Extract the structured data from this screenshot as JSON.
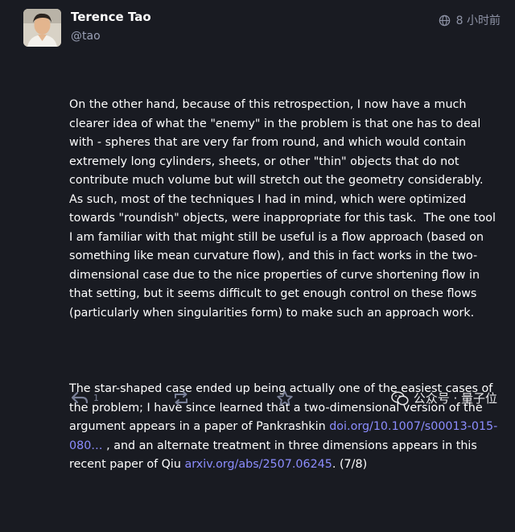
{
  "author": {
    "name": "Terence Tao",
    "handle": "@tao"
  },
  "meta": {
    "time_ago": "8 小时前",
    "globe_icon": "globe-icon"
  },
  "post": {
    "paragraph1": "On the other hand, because of this retrospection, I now have a much clearer idea of what the \"enemy\" in the problem is that one has to deal with - spheres that are very far from round, and which would contain extremely long cylinders, sheets, or other \"thin\" objects that do not contribute much volume but will stretch out the geometry considerably.  As such, most of the techniques I had in mind, which were optimized towards \"roundish\" objects, were inappropriate for this task.  The one tool I am familiar with that might still be useful is a flow approach (based on something like mean curvature flow), and this in fact works in the two-dimensional case due to the nice properties of curve shortening flow in that setting, but it seems difficult to get enough control on these flows (particularly when singularities form) to make such an approach work.",
    "paragraph2_a": "The star-shaped case ended up being actually one of the easiest cases of the problem; I have since learned that a two-dimensional version of the argument appears in a paper of Pankrashkin ",
    "link1": "doi.org/10.1007/s00013-015-080…",
    "paragraph2_b": " , and an alternate treatment in three dimensions appears in this recent paper of Qiu ",
    "link2": "arxiv.org/abs/2507.06245",
    "paragraph2_c": ". (7/8)"
  },
  "actions": {
    "reply_count": "1"
  },
  "watermark": {
    "text": "公众号 · 量子位"
  },
  "colors": {
    "background": "#191b22",
    "link": "#8c8dff",
    "muted": "#9aa0b5"
  }
}
